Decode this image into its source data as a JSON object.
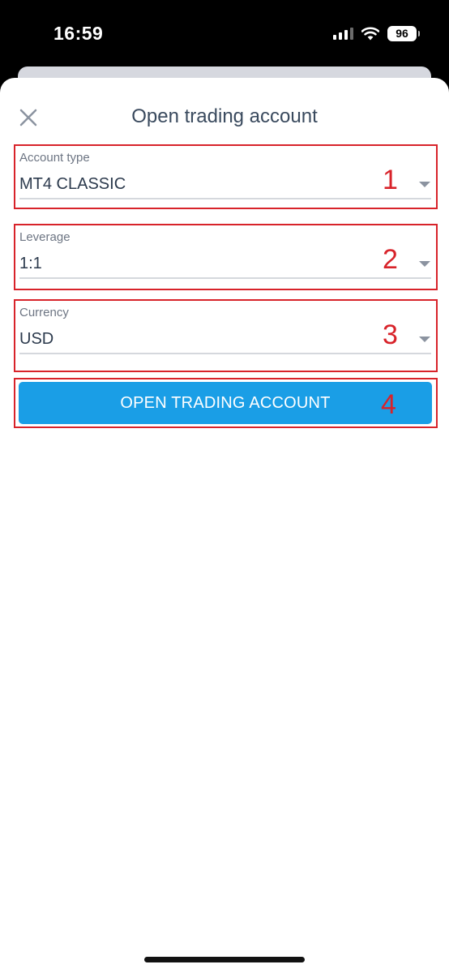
{
  "status_bar": {
    "time": "16:59",
    "battery": "96"
  },
  "sheet": {
    "title": "Open trading account"
  },
  "fields": [
    {
      "label": "Account type",
      "value": "MT4 CLASSIC",
      "marker": "1"
    },
    {
      "label": "Leverage",
      "value": "1:1",
      "marker": "2"
    },
    {
      "label": "Currency",
      "value": "USD",
      "marker": "3"
    }
  ],
  "submit": {
    "label": "OPEN TRADING ACCOUNT",
    "marker": "4"
  },
  "icons": {
    "close": "close-icon",
    "dropdown": "chevron-down-icon",
    "signal": "signal-icon",
    "wifi": "wifi-icon",
    "battery": "battery-icon"
  },
  "colors": {
    "accent": "#1a9ee6",
    "annotation": "#d8232a",
    "title": "#3a4a5e"
  }
}
